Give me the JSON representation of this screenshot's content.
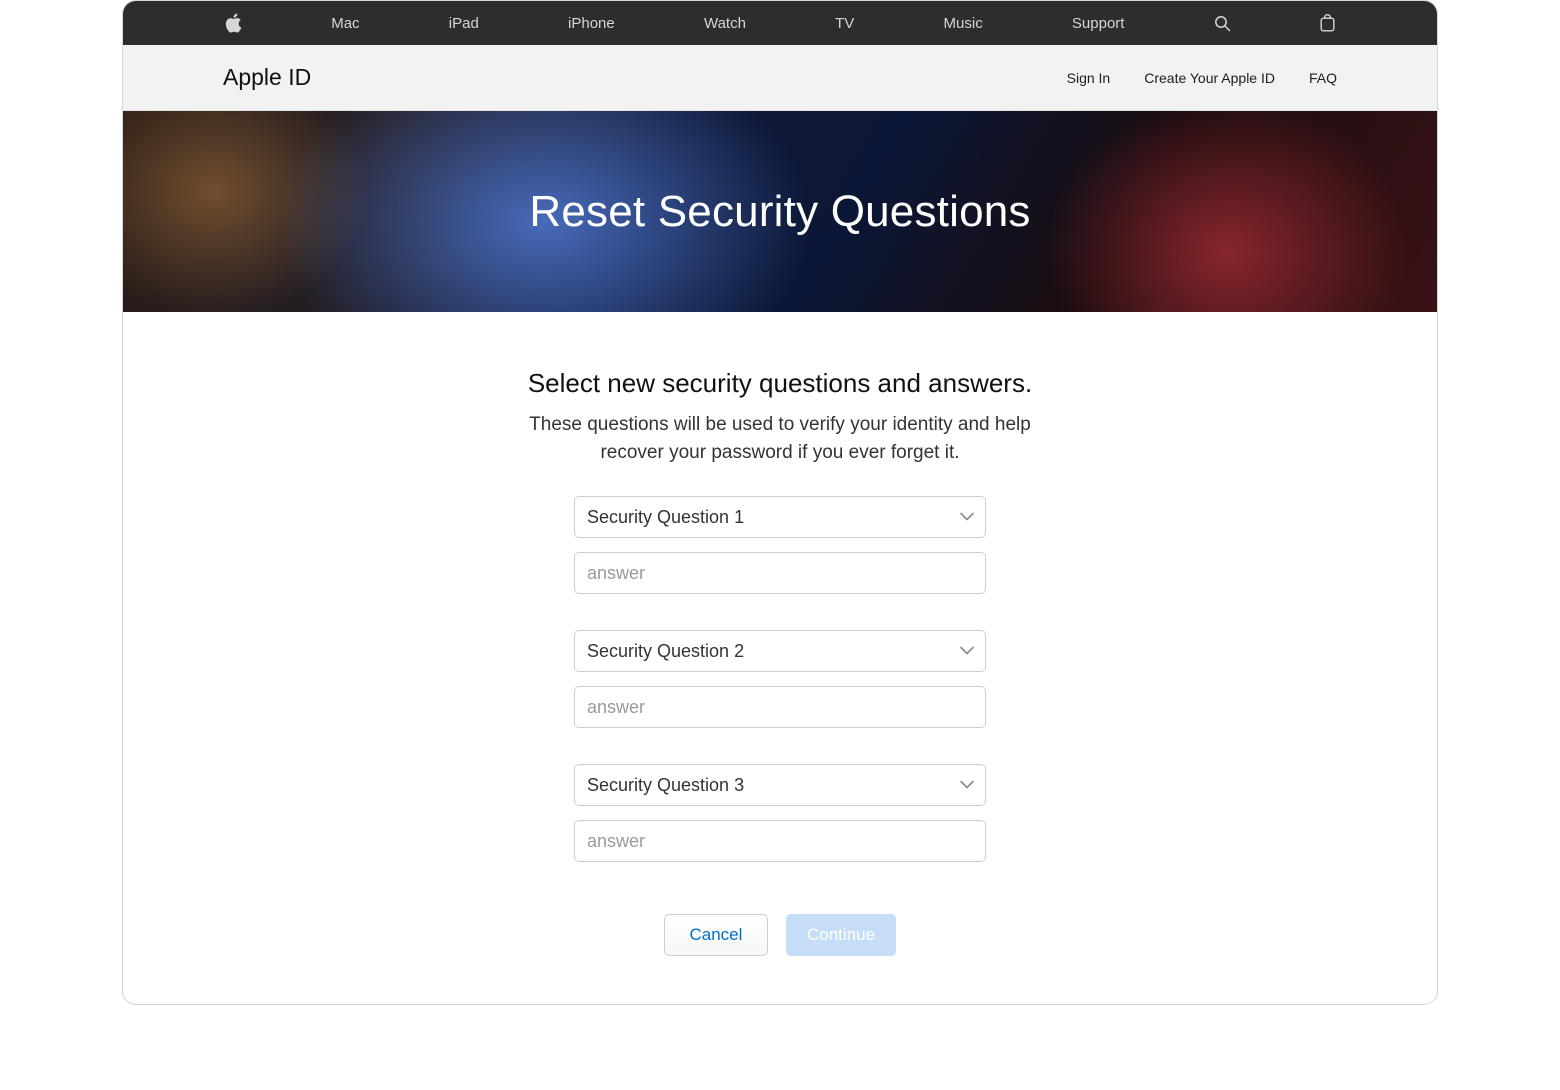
{
  "globalnav": {
    "items": [
      "Mac",
      "iPad",
      "iPhone",
      "Watch",
      "TV",
      "Music",
      "Support"
    ]
  },
  "subnav": {
    "title": "Apple ID",
    "links": [
      "Sign In",
      "Create Your Apple ID",
      "FAQ"
    ]
  },
  "hero": {
    "title": "Reset Security Questions"
  },
  "main": {
    "heading": "Select new security questions and answers.",
    "description": "These questions will be used to verify your identity and help recover your password if you ever forget it.",
    "questions": [
      {
        "label": "Security Question 1",
        "answer_placeholder": "answer"
      },
      {
        "label": "Security Question 2",
        "answer_placeholder": "answer"
      },
      {
        "label": "Security Question 3",
        "answer_placeholder": "answer"
      }
    ],
    "buttons": {
      "cancel": "Cancel",
      "continue": "Continue"
    }
  }
}
